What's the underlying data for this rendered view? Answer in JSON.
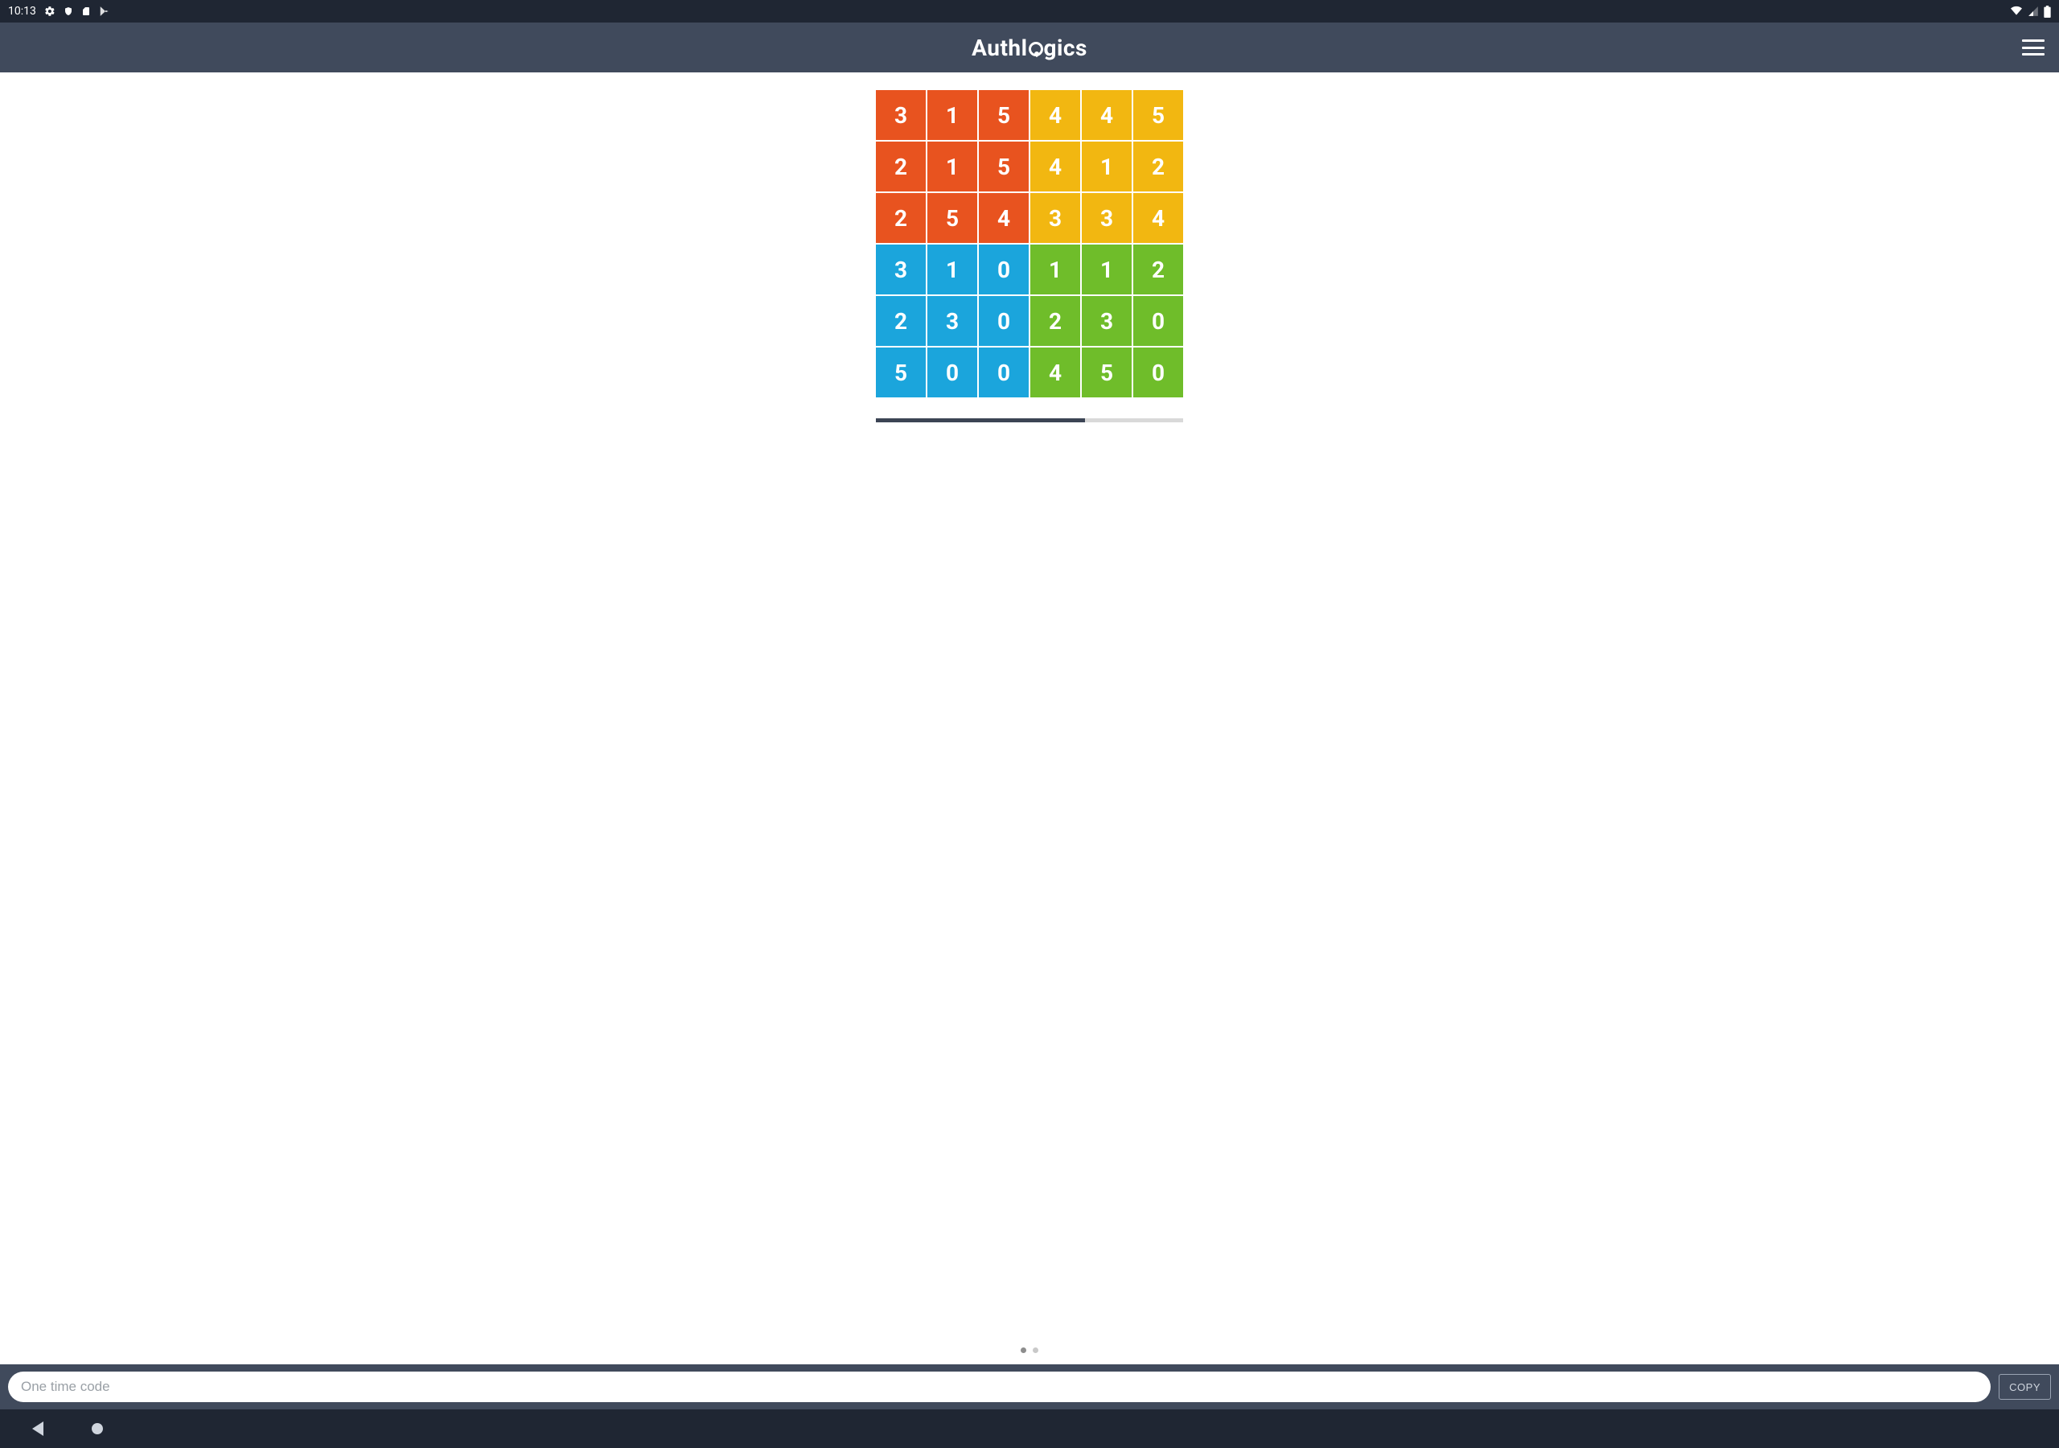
{
  "status": {
    "time": "10:13"
  },
  "header": {
    "brand_prefix": "Authl",
    "brand_suffix": "gics"
  },
  "grid": {
    "rows": [
      [
        {
          "v": "3",
          "c": "orange"
        },
        {
          "v": "1",
          "c": "orange"
        },
        {
          "v": "5",
          "c": "orange"
        },
        {
          "v": "4",
          "c": "yellow"
        },
        {
          "v": "4",
          "c": "yellow"
        },
        {
          "v": "5",
          "c": "yellow"
        }
      ],
      [
        {
          "v": "2",
          "c": "orange"
        },
        {
          "v": "1",
          "c": "orange"
        },
        {
          "v": "5",
          "c": "orange"
        },
        {
          "v": "4",
          "c": "yellow"
        },
        {
          "v": "1",
          "c": "yellow"
        },
        {
          "v": "2",
          "c": "yellow"
        }
      ],
      [
        {
          "v": "2",
          "c": "orange"
        },
        {
          "v": "5",
          "c": "orange"
        },
        {
          "v": "4",
          "c": "orange"
        },
        {
          "v": "3",
          "c": "yellow"
        },
        {
          "v": "3",
          "c": "yellow"
        },
        {
          "v": "4",
          "c": "yellow"
        }
      ],
      [
        {
          "v": "3",
          "c": "blue"
        },
        {
          "v": "1",
          "c": "blue"
        },
        {
          "v": "0",
          "c": "blue"
        },
        {
          "v": "1",
          "c": "green"
        },
        {
          "v": "1",
          "c": "green"
        },
        {
          "v": "2",
          "c": "green"
        }
      ],
      [
        {
          "v": "2",
          "c": "blue"
        },
        {
          "v": "3",
          "c": "blue"
        },
        {
          "v": "0",
          "c": "blue"
        },
        {
          "v": "2",
          "c": "green"
        },
        {
          "v": "3",
          "c": "green"
        },
        {
          "v": "0",
          "c": "green"
        }
      ],
      [
        {
          "v": "5",
          "c": "blue"
        },
        {
          "v": "0",
          "c": "blue"
        },
        {
          "v": "0",
          "c": "blue"
        },
        {
          "v": "4",
          "c": "green"
        },
        {
          "v": "5",
          "c": "green"
        },
        {
          "v": "0",
          "c": "green"
        }
      ]
    ]
  },
  "progress": {
    "percent": 68
  },
  "pager": {
    "count": 2,
    "active": 0
  },
  "input": {
    "placeholder": "One time code",
    "value": ""
  },
  "copy_label": "COPY"
}
